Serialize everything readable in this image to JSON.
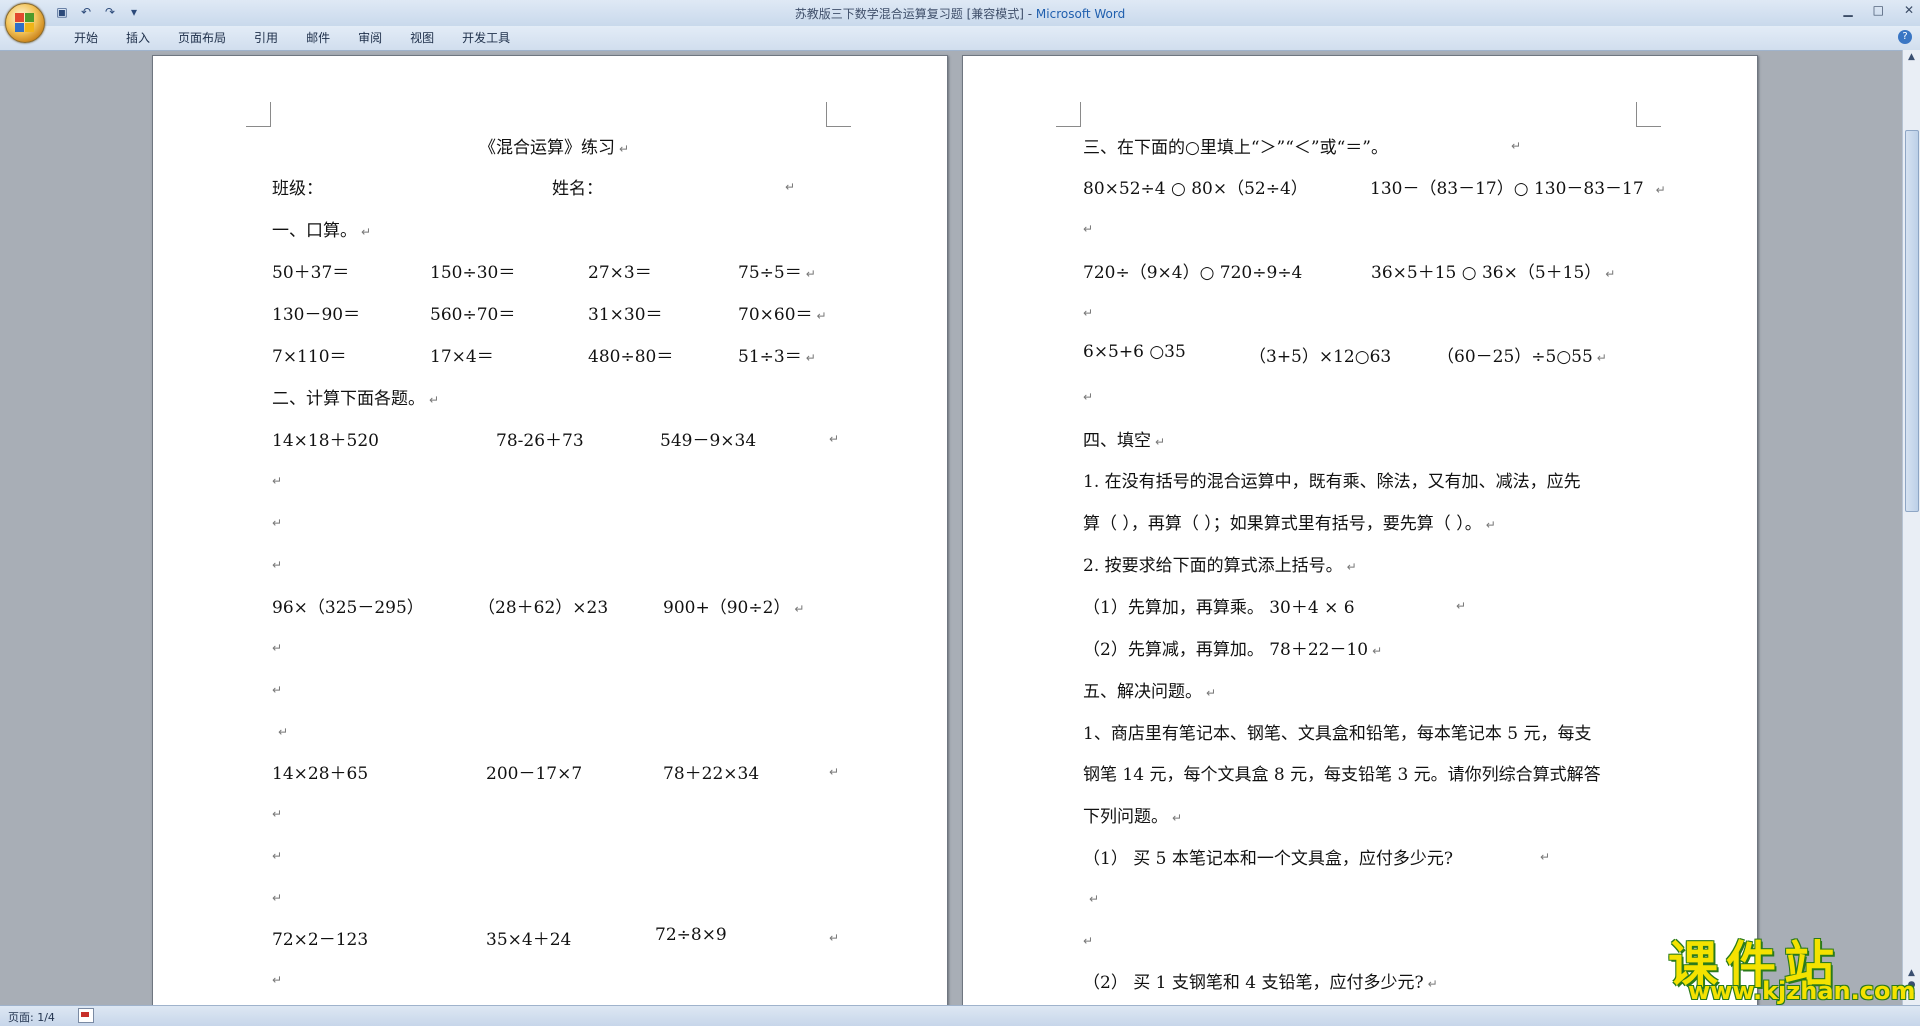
{
  "window": {
    "title_doc": "苏教版三下数学混合运算复习题 [兼容模式] - ",
    "title_app": "Microsoft Word"
  },
  "ribbon": {
    "tabs": [
      "开始",
      "插入",
      "页面布局",
      "引用",
      "邮件",
      "审阅",
      "视图",
      "开发工具"
    ]
  },
  "left_page": {
    "title": "《混合运算》练习",
    "class_label": "班级：",
    "name_label": "姓名：",
    "s1_head": "一、口算。",
    "oral": [
      [
        "50＋37＝",
        "150÷30＝",
        "27×3＝",
        "75÷5＝"
      ],
      [
        "130－90＝",
        "560÷70＝",
        "31×30＝",
        "70×60＝"
      ],
      [
        "7×110＝",
        "17×4＝",
        "480÷80＝",
        "51÷3＝"
      ]
    ],
    "s2_head": "二、计算下面各题。",
    "calc": [
      [
        "14×18＋520",
        "78-26＋73",
        "549－9×34"
      ],
      [
        " 96×（325－295）",
        "（28＋62）×23",
        "900+（90÷2）"
      ],
      [
        "14×28＋65",
        "200－17×7",
        "78＋22×34"
      ],
      [
        "72×2－123",
        "35×4＋24",
        "72÷8×9"
      ]
    ]
  },
  "right_page": {
    "s3_head": "三、在下面的○里填上“＞”“＜”或“＝”。",
    "compare": [
      [
        "80×52÷4 ○ 80×（52÷4）",
        "130－（83－17）○ 130－83－17"
      ],
      [
        "720÷（9×4）○ 720÷9÷4",
        "36×5＋15 ○ 36×（5＋15）"
      ],
      [
        "6×5+6 ○35",
        "（3+5）×12○63",
        "（60－25）÷5○55"
      ]
    ],
    "s4_head": "四、填空",
    "fill_1a": "1. 在没有括号的混合运算中，既有乘、除法，又有加、减法，应先",
    "fill_1b": "算（          ），再算（          ）；如果算式里有括号，要先算（              ）。",
    "fill_2": "2. 按要求给下面的算式添上括号。",
    "fill_2a": "（1）先算加，再算乘。 30＋4 × 6",
    "fill_2b": "（2）先算减，再算加。 78＋22－10",
    "s5_head": "五、解决问题。",
    "prob_a": "1、商店里有笔记本、钢笔、文具盒和铅笔，每本笔记本 5 元，每支",
    "prob_b": "钢笔 14 元，每个文具盒 8 元，每支铅笔 3 元。请你列综合算式解答",
    "prob_c": "下列问题。",
    "q1": "（1） 买 5 本笔记本和一个文具盒，应付多少元?",
    "q2": "（2） 买 1 支钢笔和 4 支铅笔，应付多少元?"
  },
  "status": {
    "page": "页面: 1/4"
  },
  "watermark": {
    "main": "课件站",
    "url": "www.kjzhan.com"
  }
}
